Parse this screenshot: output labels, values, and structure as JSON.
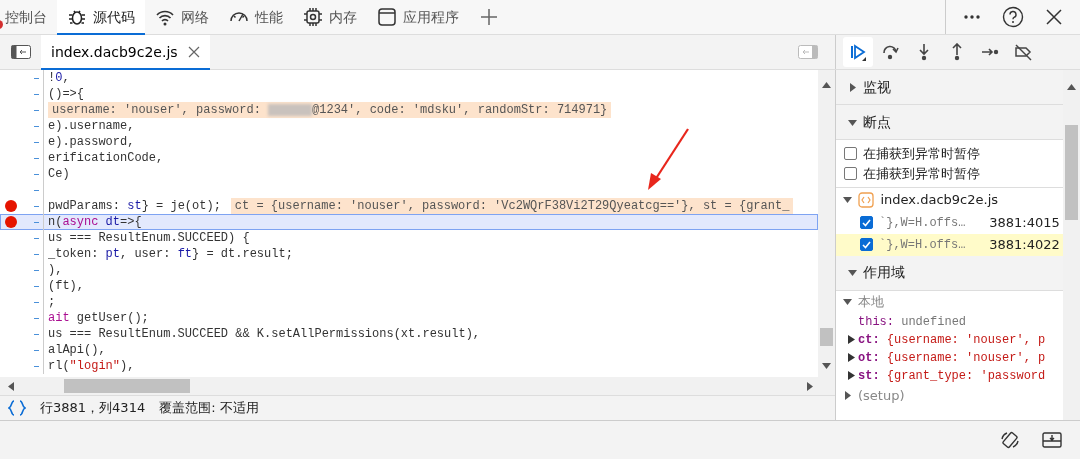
{
  "panel_tabs": [
    {
      "label": "控制台",
      "selected": false,
      "has_errors": true
    },
    {
      "label": "源代码",
      "selected": true,
      "has_errors": false
    },
    {
      "label": "网络",
      "selected": false,
      "has_errors": false
    },
    {
      "label": "性能",
      "selected": false,
      "has_errors": false
    },
    {
      "label": "内存",
      "selected": false,
      "has_errors": false
    },
    {
      "label": "应用程序",
      "selected": false,
      "has_errors": false
    }
  ],
  "file_tabs": [
    {
      "label": "index.dacb9c2e.js",
      "selected": true
    }
  ],
  "debug_controls": [
    {
      "active": true
    },
    {
      "active": false
    },
    {
      "active": false
    },
    {
      "active": false
    },
    {
      "active": false
    },
    {
      "active": false
    }
  ],
  "code": {
    "annotation_arrow": true,
    "lines": [
      {
        "breakpoint": false,
        "current": false,
        "tokens": [
          {
            "text": "!",
            "kind": "plain"
          },
          {
            "text": "0",
            "kind": "var"
          },
          {
            "text": ",",
            "kind": "plain"
          }
        ]
      },
      {
        "breakpoint": false,
        "current": false,
        "tokens": [
          {
            "text": "()=>{",
            "kind": "plain"
          }
        ]
      },
      {
        "breakpoint": false,
        "current": false,
        "inline_value": {
          "parts": [
            "username: 'nouser', password: ",
            "@1234', code: 'mdsku', randomStr: 714971}"
          ],
          "redacted": true
        }
      },
      {
        "breakpoint": false,
        "current": false,
        "tokens": [
          {
            "text": "e).username,",
            "kind": "plain"
          }
        ]
      },
      {
        "breakpoint": false,
        "current": false,
        "tokens": [
          {
            "text": "e).password,",
            "kind": "plain"
          }
        ]
      },
      {
        "breakpoint": false,
        "current": false,
        "tokens": [
          {
            "text": "erificationCode,",
            "kind": "plain"
          }
        ]
      },
      {
        "breakpoint": false,
        "current": false,
        "tokens": [
          {
            "text": "Ce)",
            "kind": "plain"
          }
        ]
      },
      {
        "breakpoint": false,
        "current": false
      },
      {
        "breakpoint": true,
        "current": false,
        "tokens": [
          {
            "text": "pwdParams: ",
            "kind": "plain"
          },
          {
            "text": "st",
            "kind": "var"
          },
          {
            "text": "} = je(ot);",
            "kind": "plain"
          }
        ],
        "inline_value": {
          "parts": [
            "ct = {username: 'nouser', password: 'Vc2WQrF38Vi2T29Qyeatcg=='}, st = {grant_"
          ]
        }
      },
      {
        "breakpoint": true,
        "current": true,
        "tokens": [
          {
            "text": "n(",
            "kind": "plain"
          },
          {
            "text": "async",
            "kind": "keyword"
          },
          {
            "text": " dt",
            "kind": "var"
          },
          {
            "text": "=>{",
            "kind": "plain"
          }
        ]
      },
      {
        "breakpoint": false,
        "current": false,
        "tokens": [
          {
            "text": "us === ResultEnum.SUCCEED) {",
            "kind": "plain"
          }
        ]
      },
      {
        "breakpoint": false,
        "current": false,
        "tokens": [
          {
            "text": "_token: ",
            "kind": "plain"
          },
          {
            "text": "pt",
            "kind": "var"
          },
          {
            "text": ", user: ",
            "kind": "plain"
          },
          {
            "text": "ft",
            "kind": "var"
          },
          {
            "text": "} = dt.result;",
            "kind": "plain"
          }
        ]
      },
      {
        "breakpoint": false,
        "current": false,
        "tokens": [
          {
            "text": "),",
            "kind": "plain"
          }
        ]
      },
      {
        "breakpoint": false,
        "current": false,
        "tokens": [
          {
            "text": "(ft),",
            "kind": "plain"
          }
        ]
      },
      {
        "breakpoint": false,
        "current": false,
        "tokens": [
          {
            "text": ";",
            "kind": "plain"
          }
        ]
      },
      {
        "breakpoint": false,
        "current": false,
        "tokens": [
          {
            "text": "ait",
            "kind": "keyword"
          },
          {
            "text": " getUser();",
            "kind": "plain"
          }
        ]
      },
      {
        "breakpoint": false,
        "current": false,
        "tokens": [
          {
            "text": "us === ResultEnum.SUCCEED && K.setAllPermissions(xt.result),",
            "kind": "plain"
          }
        ]
      },
      {
        "breakpoint": false,
        "current": false,
        "tokens": [
          {
            "text": "alApi(),",
            "kind": "plain"
          }
        ]
      },
      {
        "breakpoint": false,
        "current": false,
        "tokens": [
          {
            "text": "rl(",
            "kind": "plain"
          },
          {
            "text": "\"login\"",
            "kind": "string"
          },
          {
            "text": "),",
            "kind": "plain"
          }
        ]
      }
    ]
  },
  "status_bar": {
    "position": "行3881，列4314",
    "coverage": "覆盖范围: 不适用"
  },
  "watch": {
    "title": "监视",
    "expanded": false
  },
  "breakpoints": {
    "title": "断点",
    "expanded": true,
    "options": [
      {
        "label": "在捕获到异常时暂停",
        "checked": false
      },
      {
        "label": "在捕获到异常时暂停",
        "checked": false
      }
    ],
    "files": [
      {
        "name": "index.dacb9c2e.js",
        "expanded": true,
        "items": [
          {
            "code": "`},W=H.offs…",
            "location": "3881:4015",
            "checked": true,
            "selected": false
          },
          {
            "code": "`},W=H.offs…",
            "location": "3881:4022",
            "checked": true,
            "selected": true
          }
        ]
      }
    ]
  },
  "scope": {
    "title": "作用域",
    "expanded": true,
    "groups": [
      {
        "title": "本地",
        "expanded": true,
        "vars": [
          {
            "name": "this:",
            "value": "undefined",
            "expandable": false
          },
          {
            "name": "ct:",
            "value": "{username: 'nouser', p",
            "expandable": true
          },
          {
            "name": "ot:",
            "value": "{username: 'nouser', p",
            "expandable": true
          },
          {
            "name": "st:",
            "value": "{grant_type: 'password",
            "expandable": true
          }
        ]
      },
      {
        "title": "(setup)",
        "expanded": false
      }
    ]
  }
}
